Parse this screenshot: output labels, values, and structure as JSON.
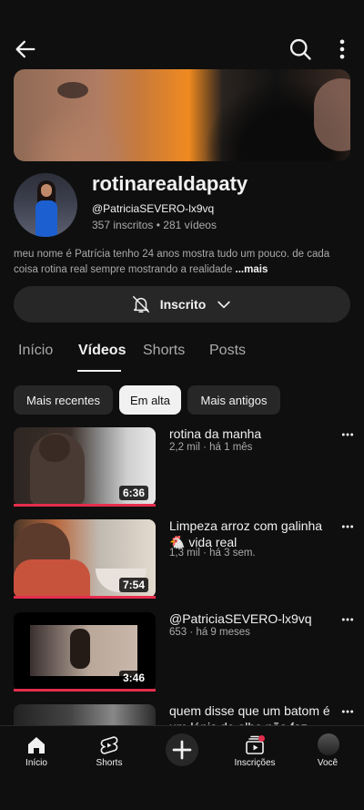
{
  "channel": {
    "name": "rotinarealdapaty",
    "handle": "@PatriciaSEVERO-lx9vq",
    "subscribers": "357 inscritos",
    "videos_count": "281 vídeos",
    "separator": "•",
    "description": "meu nome é Patrícia tenho 24 anos mostra tudo um pouco. de cada coisa rotina real sempre mostrando a realidade ",
    "more_label": "...mais"
  },
  "subscribe": {
    "label": "Inscrito",
    "bell_icon": "bell-icon",
    "chevron_icon": "chevron-down-icon"
  },
  "tabs": [
    {
      "label": "Início",
      "active": false
    },
    {
      "label": "Vídeos",
      "active": true
    },
    {
      "label": "Shorts",
      "active": false
    },
    {
      "label": "Posts",
      "active": false
    }
  ],
  "chips": [
    {
      "label": "Mais recentes",
      "active": false
    },
    {
      "label": "Em alta",
      "active": true
    },
    {
      "label": "Mais antigos",
      "active": false
    }
  ],
  "videos": [
    {
      "title": "rotina da manha",
      "views": "2,2 mil",
      "age": "há 1 mês",
      "duration": "6:36",
      "meta_sep": "·"
    },
    {
      "title": "Limpeza arroz com galinha 🐔 vida real",
      "views": "1,3 mil",
      "age": "há 3 sem.",
      "duration": "7:54",
      "meta_sep": "·"
    },
    {
      "title": "@PatriciaSEVERO-lx9vq",
      "views": "653",
      "age": "há 9 meses",
      "duration": "3:46",
      "meta_sep": "·"
    },
    {
      "title": "quem disse que um batom é um lápis de olho não faz"
    }
  ],
  "bottom_nav": [
    {
      "label": "Início",
      "icon": "home-icon"
    },
    {
      "label": "Shorts",
      "icon": "shorts-icon"
    },
    {
      "label": "",
      "icon": "create-icon"
    },
    {
      "label": "Inscrições",
      "icon": "subscriptions-icon"
    },
    {
      "label": "Você",
      "icon": "avatar"
    }
  ],
  "colors": {
    "background": "#0f0f0f",
    "surface": "#272727",
    "text": "#f1f1f1",
    "secondary_text": "#aaaaaa",
    "progress": "#e52d4d"
  }
}
